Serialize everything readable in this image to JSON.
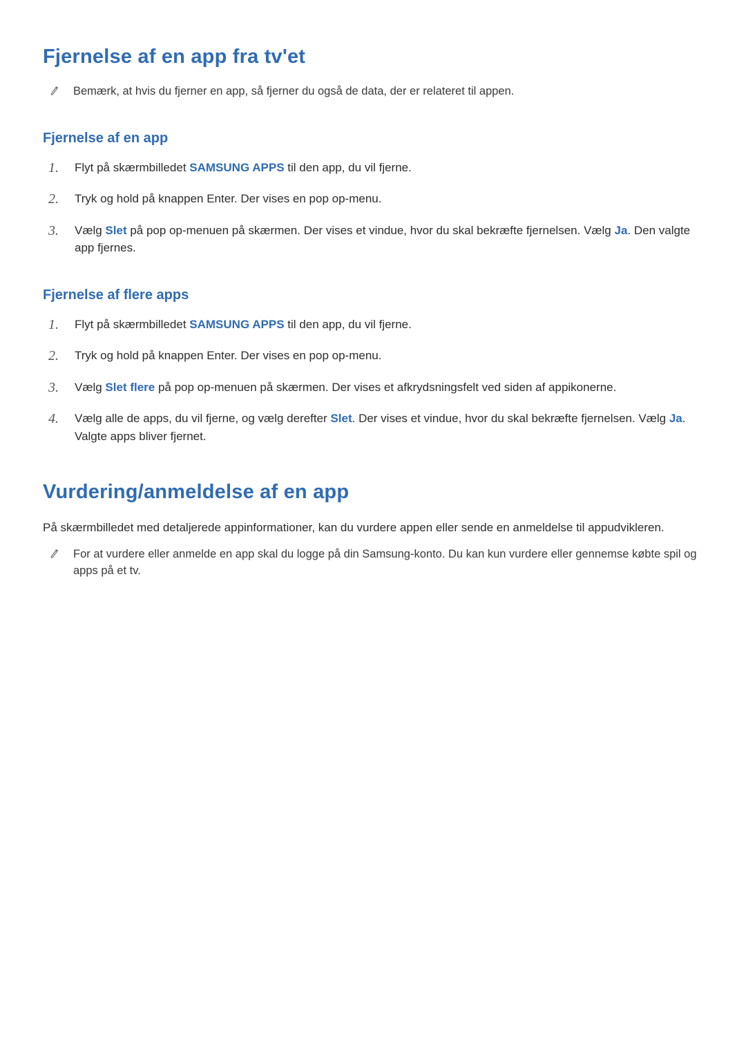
{
  "section1": {
    "title": "Fjernelse af en app fra tv'et",
    "note": "Bemærk, at hvis du fjerner en app, så fjerner du også de data, der er relateret til appen.",
    "sub1": {
      "title": "Fjernelse af en app",
      "steps": {
        "s1a": "Flyt på skærmbilledet ",
        "s1b": "SAMSUNG APPS",
        "s1c": " til den app, du vil fjerne.",
        "s2": "Tryk og hold på knappen Enter. Der vises en pop op-menu.",
        "s3a": "Vælg ",
        "s3b": "Slet",
        "s3c": " på pop op-menuen på skærmen. Der vises et vindue, hvor du skal bekræfte fjernelsen. Vælg ",
        "s3d": "Ja",
        "s3e": ". Den valgte app fjernes."
      }
    },
    "sub2": {
      "title": "Fjernelse af flere apps",
      "steps": {
        "s1a": "Flyt på skærmbilledet ",
        "s1b": "SAMSUNG APPS",
        "s1c": " til den app, du vil fjerne.",
        "s2": "Tryk og hold på knappen Enter. Der vises en pop op-menu.",
        "s3a": "Vælg ",
        "s3b": "Slet flere",
        "s3c": " på pop op-menuen på skærmen. Der vises et afkrydsningsfelt ved siden af appikonerne.",
        "s4a": "Vælg alle de apps, du vil fjerne, og vælg derefter ",
        "s4b": "Slet",
        "s4c": ". Der vises et vindue, hvor du skal bekræfte fjernelsen. Vælg ",
        "s4d": "Ja",
        "s4e": ". Valgte apps bliver fjernet."
      }
    }
  },
  "section2": {
    "title": "Vurdering/anmeldelse af en app",
    "body": "På skærmbilledet med detaljerede appinformationer, kan du vurdere appen eller sende en anmeldelse til appudvikleren.",
    "note": "For at vurdere eller anmelde en app skal du logge på din Samsung-konto. Du kan kun vurdere eller gennemse købte spil og apps på et tv."
  }
}
